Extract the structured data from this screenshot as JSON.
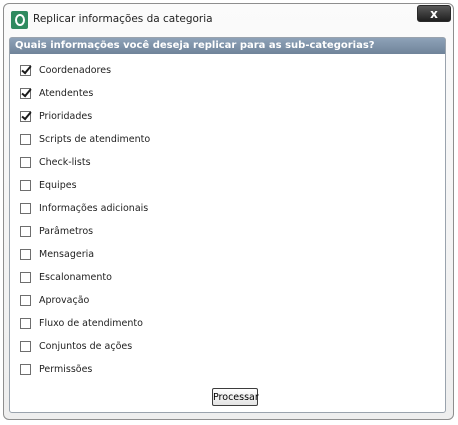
{
  "dialog": {
    "title": "Replicar informações da categoria",
    "close_label": "x"
  },
  "panel": {
    "header": "Quais informações você deseja replicar para as sub-categorias?"
  },
  "options": [
    {
      "label": "Coordenadores",
      "checked": true
    },
    {
      "label": "Atendentes",
      "checked": true
    },
    {
      "label": "Prioridades",
      "checked": true
    },
    {
      "label": "Scripts de atendimento",
      "checked": false
    },
    {
      "label": "Check-lists",
      "checked": false
    },
    {
      "label": "Equipes",
      "checked": false
    },
    {
      "label": "Informações adicionais",
      "checked": false
    },
    {
      "label": "Parâmetros",
      "checked": false
    },
    {
      "label": "Mensageria",
      "checked": false
    },
    {
      "label": "Escalonamento",
      "checked": false
    },
    {
      "label": "Aprovação",
      "checked": false
    },
    {
      "label": "Fluxo de atendimento",
      "checked": false
    },
    {
      "label": "Conjuntos de ações",
      "checked": false
    },
    {
      "label": "Permissões",
      "checked": false
    }
  ],
  "actions": {
    "process_label": "Processar"
  }
}
